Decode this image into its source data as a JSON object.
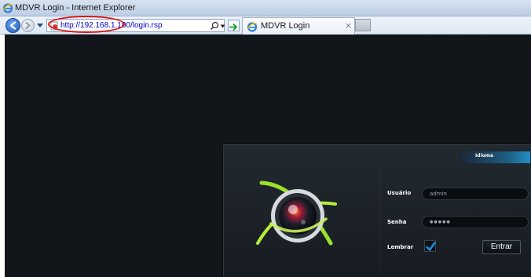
{
  "window": {
    "title": "MDVR Login - Internet Explorer"
  },
  "address_bar": {
    "url": "http://192.168.1.100/login.rsp"
  },
  "tab": {
    "label": "MDVR Login",
    "close": "×"
  },
  "login": {
    "language_label": "Idioma",
    "username_label": "Usuário",
    "username_value": "admin",
    "password_label": "Senha",
    "password_value": "●●●●●",
    "remember_label": "Lembrar",
    "remember_checked": true,
    "enter_button": "Entrar"
  },
  "icons": {
    "ie": "internet-explorer-icon",
    "back": "back-arrow-icon",
    "forward": "forward-arrow-icon",
    "search": "search-icon",
    "go": "go-arrow-icon",
    "logo": "camera-lens-icon",
    "check": "checkmark-icon"
  },
  "colors": {
    "page_background": "#12161b",
    "accent_blue": "#2390c4",
    "logo_green": "#9be22c",
    "annotation_red": "#dd1111"
  }
}
